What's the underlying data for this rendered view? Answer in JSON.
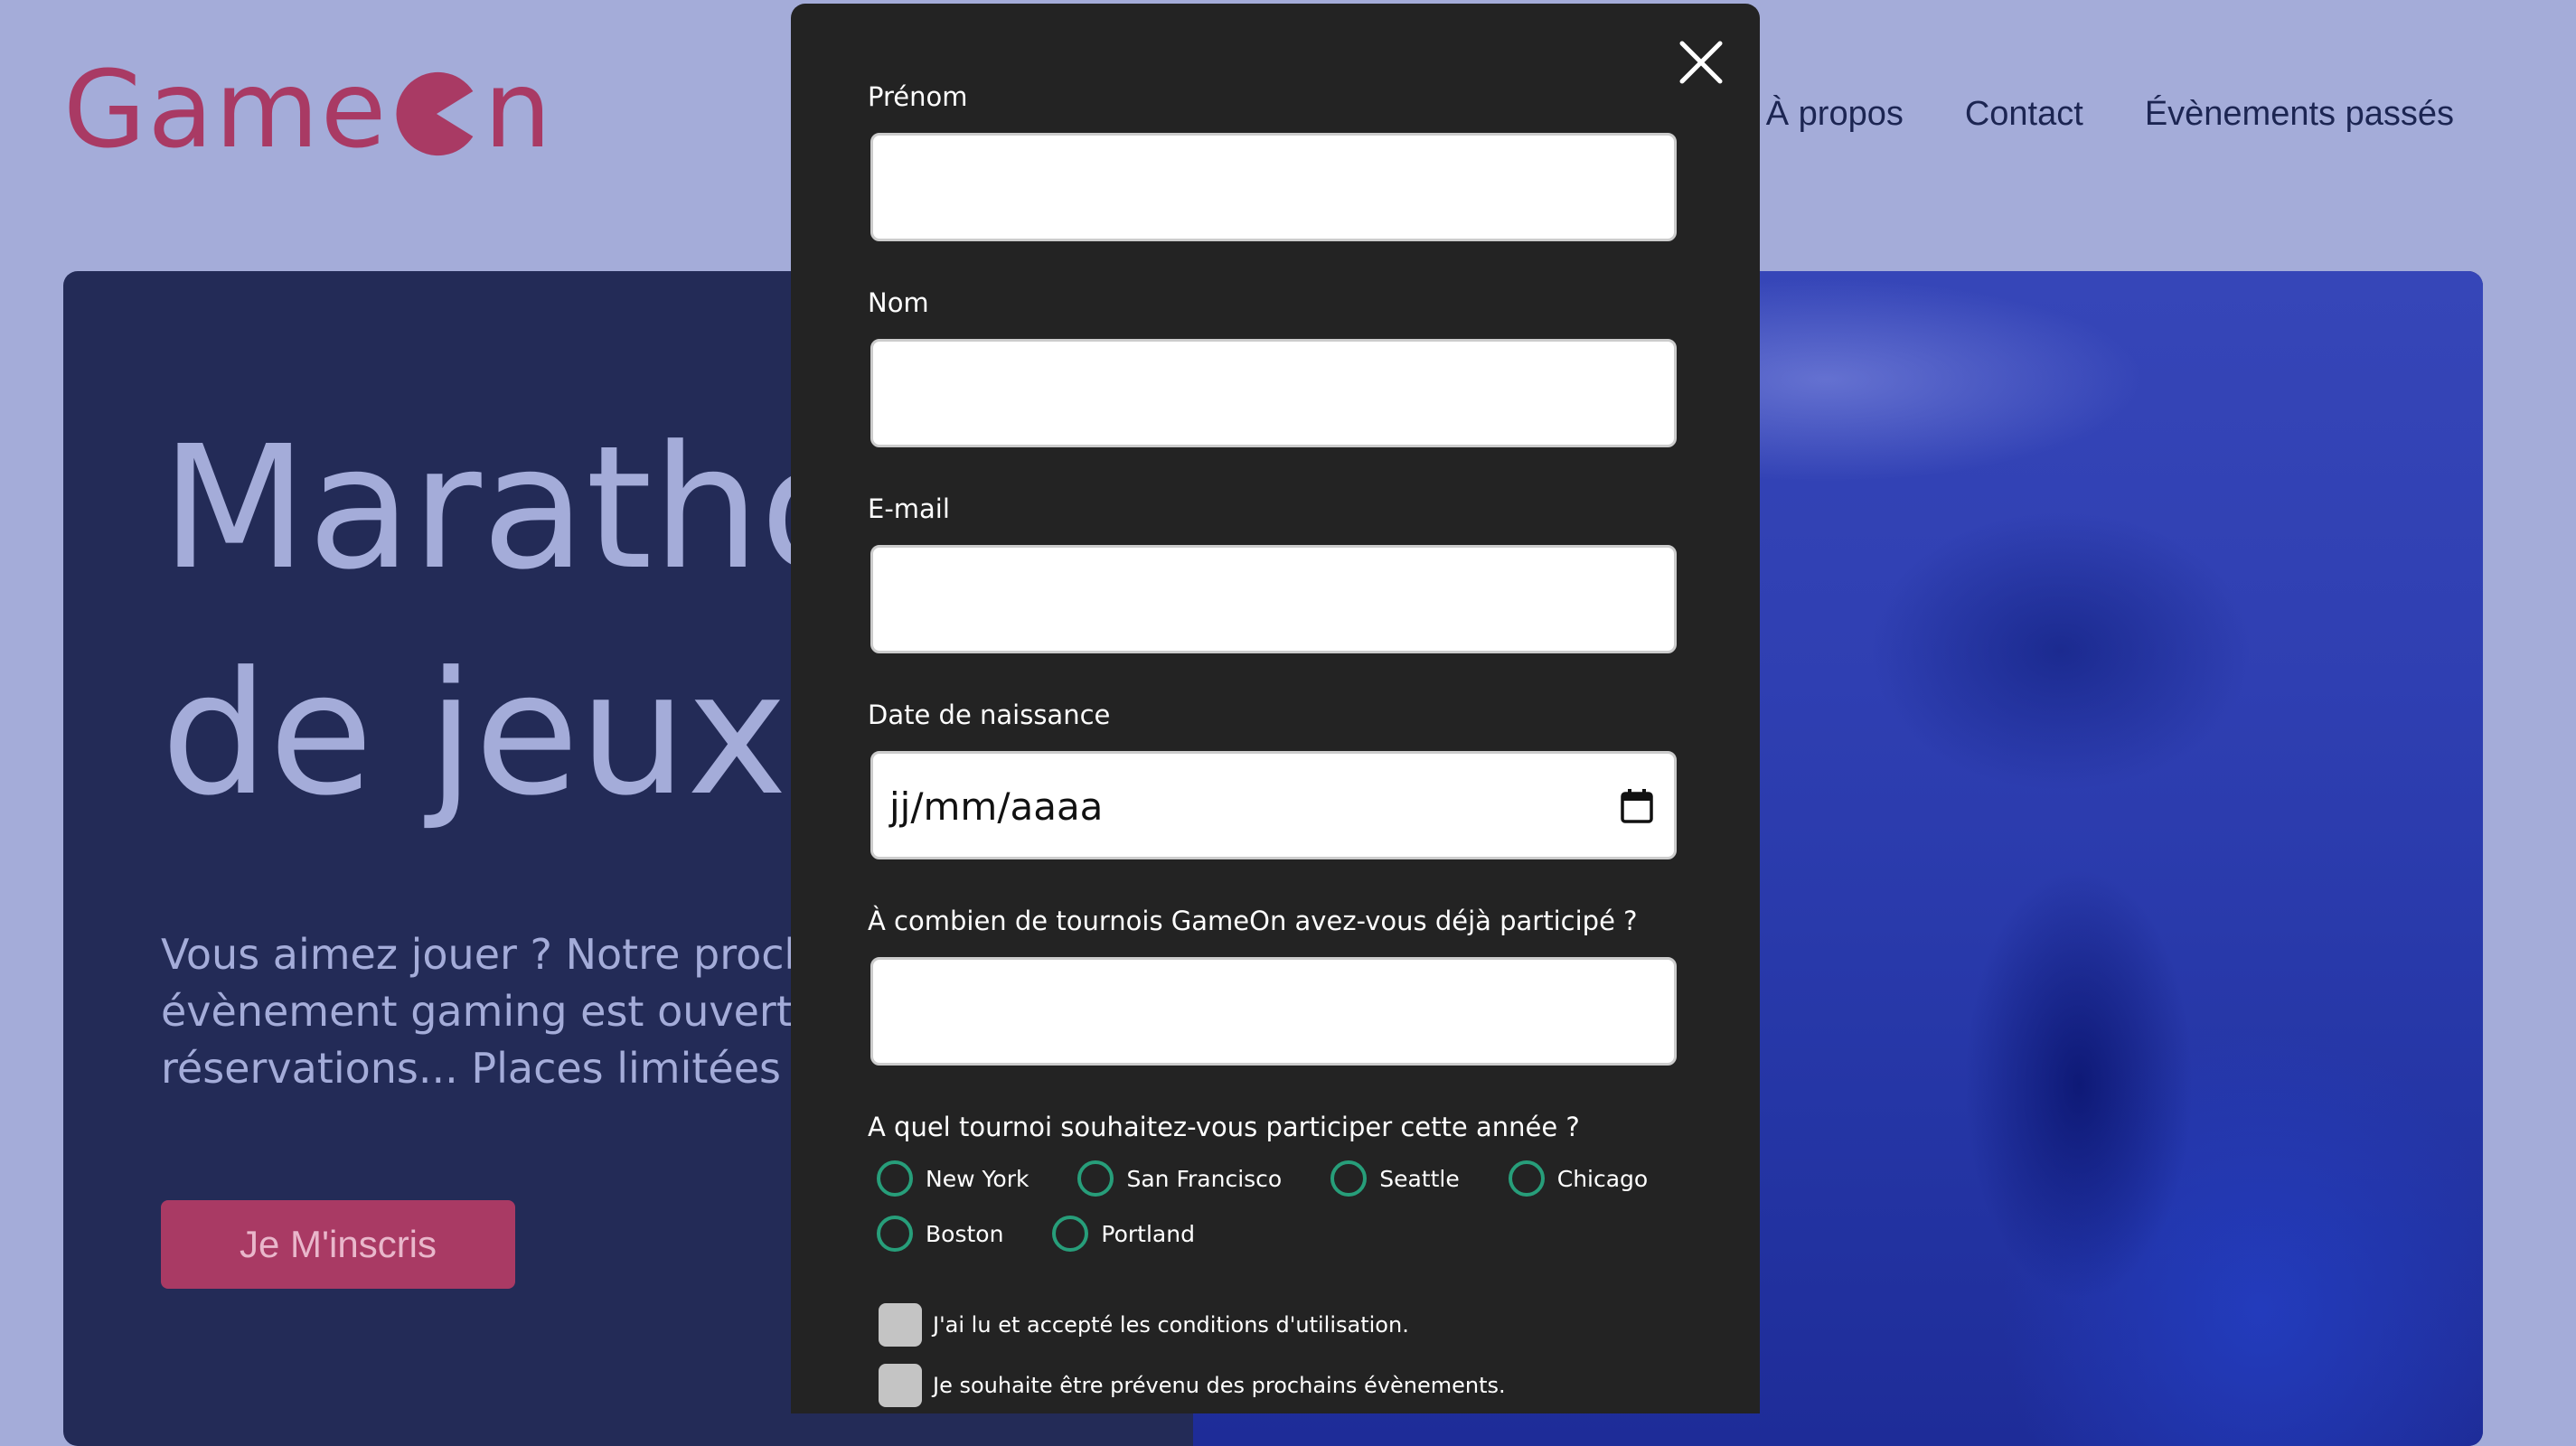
{
  "header": {
    "logo_text_start": "Game",
    "logo_text_end": "n",
    "logo_color": "#a93a64",
    "nav": [
      "À propos",
      "Contact",
      "Évènements passés"
    ]
  },
  "hero": {
    "title_line1": "Marathon",
    "title_line2": "de jeux",
    "text": "Vous aimez jouer ? Notre prochain évènement gaming est ouvert aux réservations... Places limitées !",
    "cta_label": "Je M'inscris",
    "cta_color": "#a93a64"
  },
  "modal": {
    "close_icon": "close-icon",
    "fields": [
      {
        "label": "Prénom",
        "value": ""
      },
      {
        "label": "Nom",
        "value": ""
      },
      {
        "label": "E-mail",
        "value": ""
      },
      {
        "label": "Date de naissance",
        "value": "jj/mm/aaaa",
        "icon": "calendar-icon"
      },
      {
        "label": "À combien de tournois GameOn avez-vous déjà participé ?",
        "value": ""
      }
    ],
    "tournament_question": "A quel tournoi souhaitez-vous participer cette année ?",
    "locations": [
      "New York",
      "San Francisco",
      "Seattle",
      "Chicago",
      "Boston",
      "Portland"
    ],
    "radio_color": "#279e7a",
    "checkboxes": [
      {
        "label": "J'ai lu et accepté les conditions d'utilisation.",
        "checked": false
      },
      {
        "label": "Je souhaite être prévenu des prochains évènements.",
        "checked": false
      }
    ]
  }
}
